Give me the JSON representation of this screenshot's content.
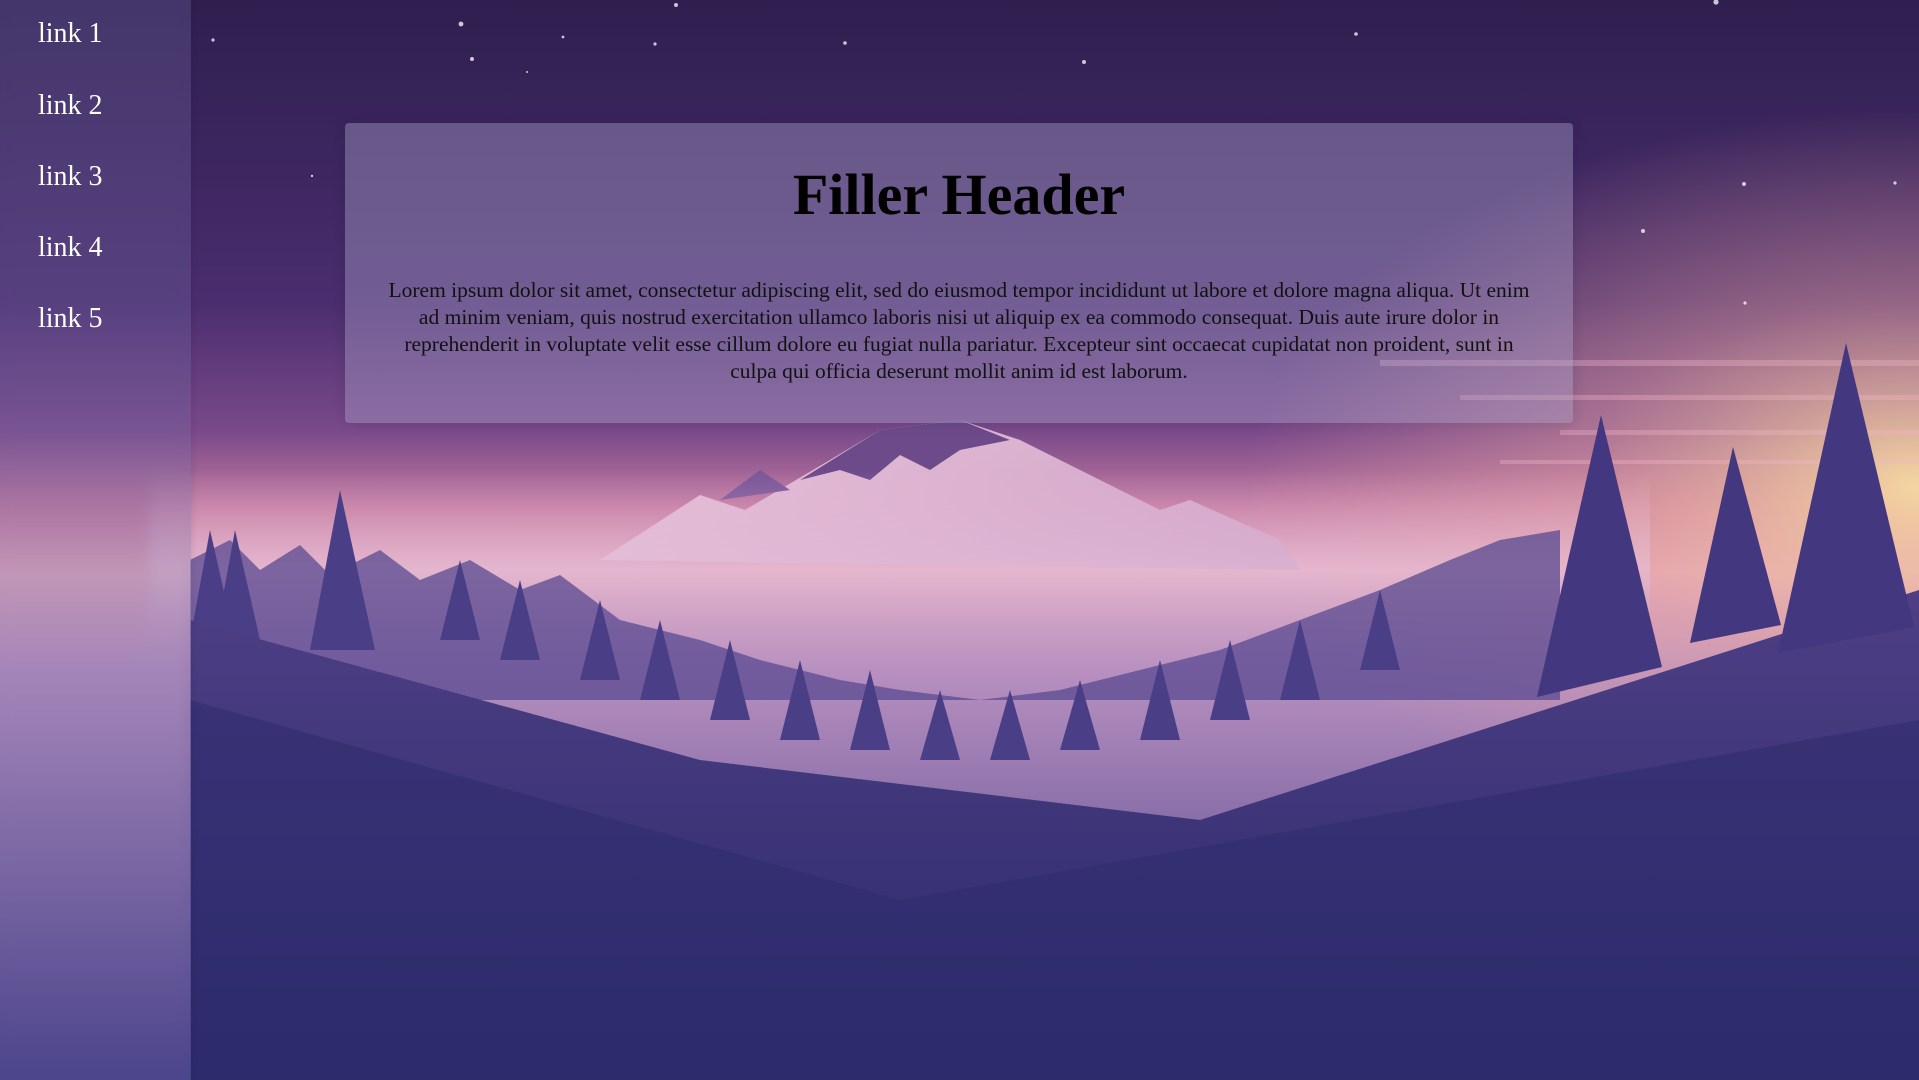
{
  "sidebar": {
    "links": [
      {
        "label": "link 1"
      },
      {
        "label": "link 2"
      },
      {
        "label": "link 3"
      },
      {
        "label": "link 4"
      },
      {
        "label": "link 5"
      }
    ]
  },
  "main": {
    "header": "Filler Header",
    "body": "Lorem ipsum dolor sit amet, consectetur adipiscing elit, sed do eiusmod tempor incididunt ut labore et dolore magna aliqua. Ut enim ad minim veniam, quis nostrud exercitation ullamco laboris nisi ut aliquip ex ea commodo consequat. Duis aute irure dolor in reprehenderit in voluptate velit esse cillum dolore eu fugiat nulla pariatur. Excepteur sint occaecat cupidatat non proident, sunt in culpa qui officia deserunt mollit anim id est laborum."
  },
  "background": {
    "scene": "mountain-landscape-illustration",
    "colors": {
      "sky_top": "#2e1f4f",
      "sky_mid": "#5a3a80",
      "horizon_pink": "#d98fae",
      "horizon_glow": "#f4d0a0",
      "ground": "#2f2b6e"
    }
  }
}
